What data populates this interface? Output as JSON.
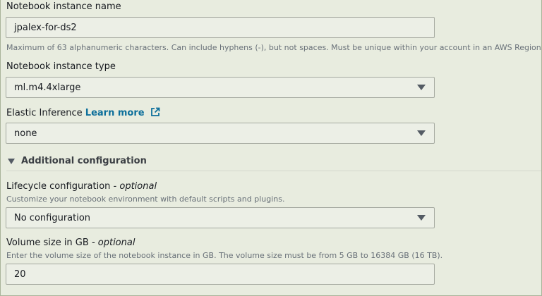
{
  "notebook_name": {
    "label": "Notebook instance name",
    "value": "jpalex-for-ds2",
    "hint": "Maximum of 63 alphanumeric characters. Can include hyphens (-), but not spaces. Must be unique within your account in an AWS Region."
  },
  "instance_type": {
    "label": "Notebook instance type",
    "selected": "ml.m4.4xlarge"
  },
  "elastic_inference": {
    "label": "Elastic Inference",
    "link": "Learn more",
    "selected": "none"
  },
  "additional_config": {
    "label": "Additional configuration",
    "expanded": true
  },
  "lifecycle": {
    "label": "Lifecycle configuration",
    "optional": "- optional",
    "hint": "Customize your notebook environment with default scripts and plugins.",
    "selected": "No configuration"
  },
  "volume": {
    "label": "Volume size in GB",
    "optional": "- optional",
    "hint": "Enter the volume size of the notebook instance in GB. The volume size must be from 5 GB to 16384 GB (16 TB).",
    "value": "20"
  },
  "icons": {
    "external_link": "external-link-icon",
    "dropdown_caret": "caret-down-icon",
    "expand_toggle": "triangle-down-icon"
  },
  "colors": {
    "background": "#e8ecdf",
    "link": "#0d6f9b",
    "hint": "#687078",
    "border": "#a5a9a0"
  }
}
